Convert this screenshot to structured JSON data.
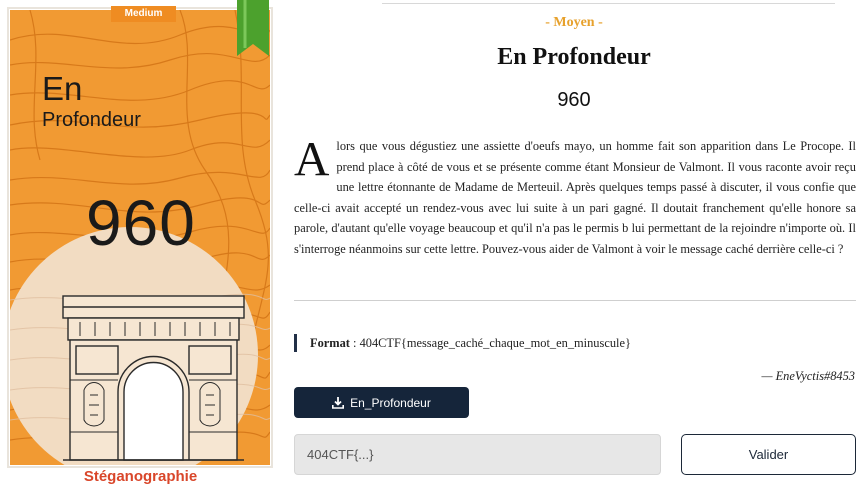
{
  "card": {
    "badge": "Medium",
    "title": "En",
    "subtitle": "Profondeur",
    "points": "960",
    "category": "Stéganographie",
    "colors": {
      "background": "#f19a33",
      "border": "#ffffff",
      "ribbon": "#4ca12d",
      "badge": "#ef8c22",
      "category": "#d9462a"
    },
    "illustration": "arc-de-triomphe"
  },
  "challenge": {
    "difficulty": "- Moyen -",
    "title": "En Profondeur",
    "points": "960",
    "description_dropcap": "A",
    "description": "lors que vous dégustiez une assiette d'oeufs mayo, un homme fait son apparition dans Le Procope. Il prend place à côté de vous et se présente comme étant Monsieur de Valmont. Il vous raconte avoir reçu une lettre étonnante de Madame de Merteuil. Après quelques temps passé à discuter, il vous confie que celle-ci avait accepté un rendez-vous avec lui suite à un pari gagné. Il doutait franchement qu'elle honore sa parole, d'autant qu'elle voyage beaucoup et qu'il n'a pas le permis b lui permettant de la rejoindre n'importe où. Il s'interroge néanmoins sur cette lettre. Pouvez-vous aider de Valmont à voir le message caché derrière celle-ci ?",
    "format_label": "Format",
    "format_value": "404CTF{message_caché_chaque_mot_en_minuscule}",
    "author": "— EneVyctis#8453"
  },
  "actions": {
    "download_label": "En_Profondeur",
    "download_icon": "download-icon",
    "flag_placeholder": "404CTF{...}",
    "validate_label": "Valider"
  },
  "colors": {
    "difficulty": "#e7a12c",
    "dark": "#15253a"
  }
}
